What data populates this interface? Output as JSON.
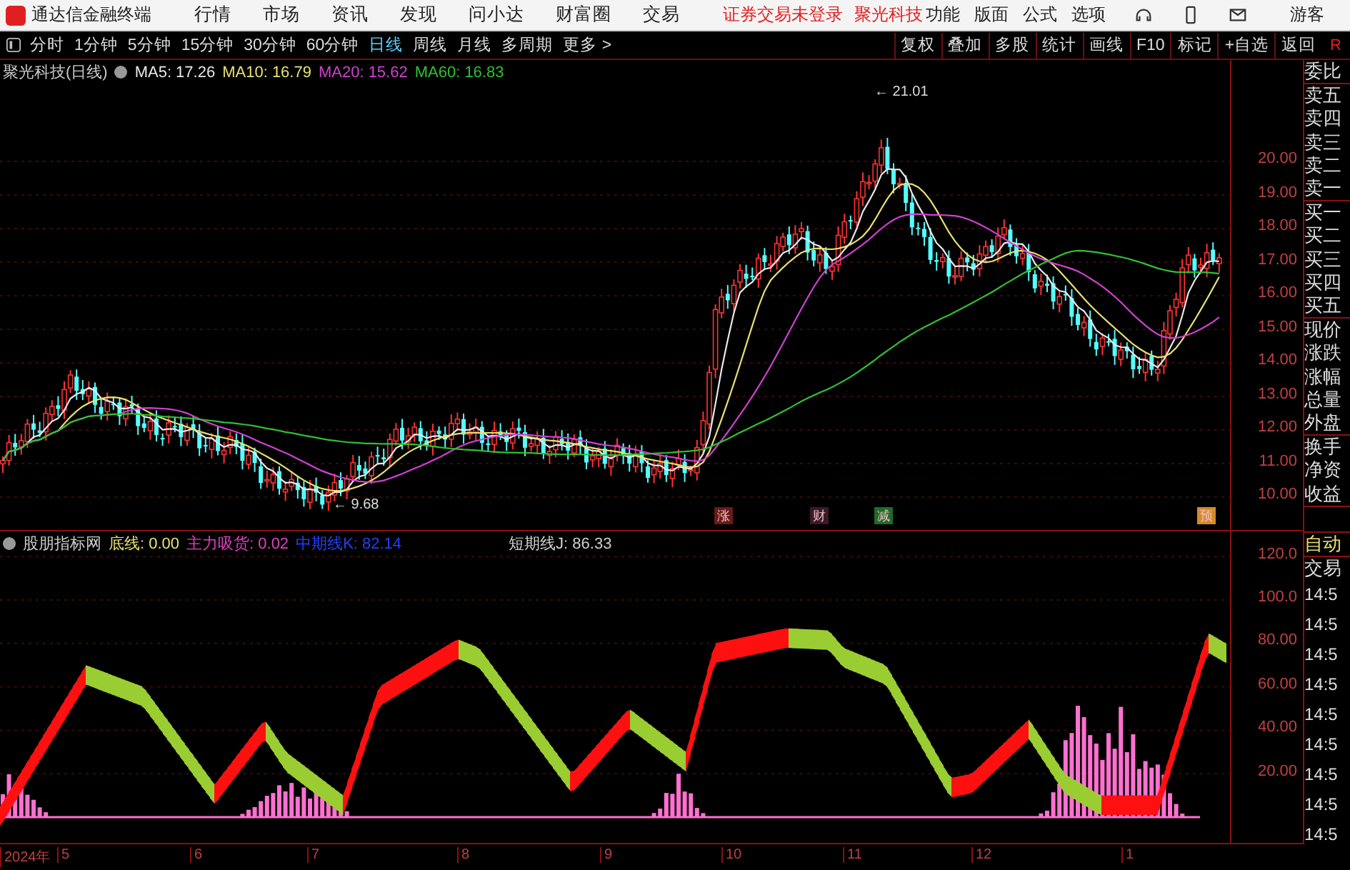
{
  "app_bar": {
    "title": "通达信金融终端",
    "menu": [
      "行情",
      "市场",
      "资讯",
      "发现",
      "问小达",
      "财富圈",
      "交易"
    ],
    "notices": [
      "证券交易未登录",
      "聚光科技"
    ],
    "right_menu": [
      "功能",
      "版面",
      "公式",
      "选项"
    ],
    "user": "游客"
  },
  "toolbar": {
    "periods": [
      {
        "label": "分时",
        "selected": false
      },
      {
        "label": "1分钟",
        "selected": false
      },
      {
        "label": "5分钟",
        "selected": false
      },
      {
        "label": "15分钟",
        "selected": false
      },
      {
        "label": "30分钟",
        "selected": false
      },
      {
        "label": "60分钟",
        "selected": false
      },
      {
        "label": "日线",
        "selected": true
      },
      {
        "label": "周线",
        "selected": false
      },
      {
        "label": "月线",
        "selected": false
      },
      {
        "label": "多周期",
        "selected": false
      },
      {
        "label": "更多 >",
        "selected": false
      }
    ],
    "buttons": [
      "复权",
      "叠加",
      "多股",
      "统计",
      "画线",
      "F10",
      "标记",
      "+自选",
      "返回"
    ],
    "corner": "R"
  },
  "price_chart": {
    "title": "聚光科技(日线)",
    "legend": [
      {
        "text": "MA5: 17.26",
        "color": "#e8e8e8"
      },
      {
        "text": "MA10: 16.79",
        "color": "#e8e070"
      },
      {
        "text": "MA20: 15.62",
        "color": "#d040d0"
      },
      {
        "text": "MA60: 16.83",
        "color": "#30c030"
      }
    ],
    "y_ticks": [
      "20.00",
      "19.00",
      "18.00",
      "17.00",
      "16.00",
      "15.00",
      "14.00",
      "13.00",
      "12.00",
      "11.00",
      "10.00"
    ],
    "high_label": "← 21.01",
    "low_label": "← 9.68",
    "event_tags": [
      {
        "text": "涨",
        "color": "#6a1a1a"
      },
      {
        "text": "财",
        "color": "#3a1a2a"
      },
      {
        "text": "减",
        "color": "#1f6a2a"
      },
      {
        "text": "预",
        "color": "#d88a2a"
      }
    ]
  },
  "indicator_chart": {
    "title": "股朋指标网",
    "legend": [
      {
        "text": "底线: 0.00",
        "color": "#e8e070"
      },
      {
        "text": "主力吸货: 0.02",
        "color": "#e040c0"
      },
      {
        "text": "中期线K: 82.14",
        "color": "#2040ff"
      },
      {
        "text": "短期线J: 86.33",
        "color": "#d0d0d0"
      }
    ],
    "y_ticks": [
      "120.0",
      "100.0",
      "80.00",
      "60.00",
      "40.00",
      "20.00"
    ]
  },
  "x_axis": [
    "2024年",
    "5",
    "6",
    "7",
    "8",
    "9",
    "10",
    "11",
    "12",
    "1"
  ],
  "quote_panel": {
    "groups": [
      [
        "委比"
      ],
      [
        "卖五",
        "卖四",
        "卖三",
        "卖二",
        "卖一"
      ],
      [
        "买一",
        "买二",
        "买三",
        "买四",
        "买五"
      ],
      [
        "现价",
        "涨跌",
        "涨幅",
        "总量",
        "外盘"
      ],
      [
        "换手",
        "净资",
        "收益"
      ]
    ],
    "modes": [
      {
        "text": "自动",
        "kind": "active"
      },
      {
        "text": "交易",
        "kind": "plain"
      }
    ],
    "times": [
      "14:5",
      "14:5",
      "14:5",
      "14:5",
      "14:5",
      "14:5",
      "14:5",
      "14:5",
      "14:5"
    ]
  }
}
